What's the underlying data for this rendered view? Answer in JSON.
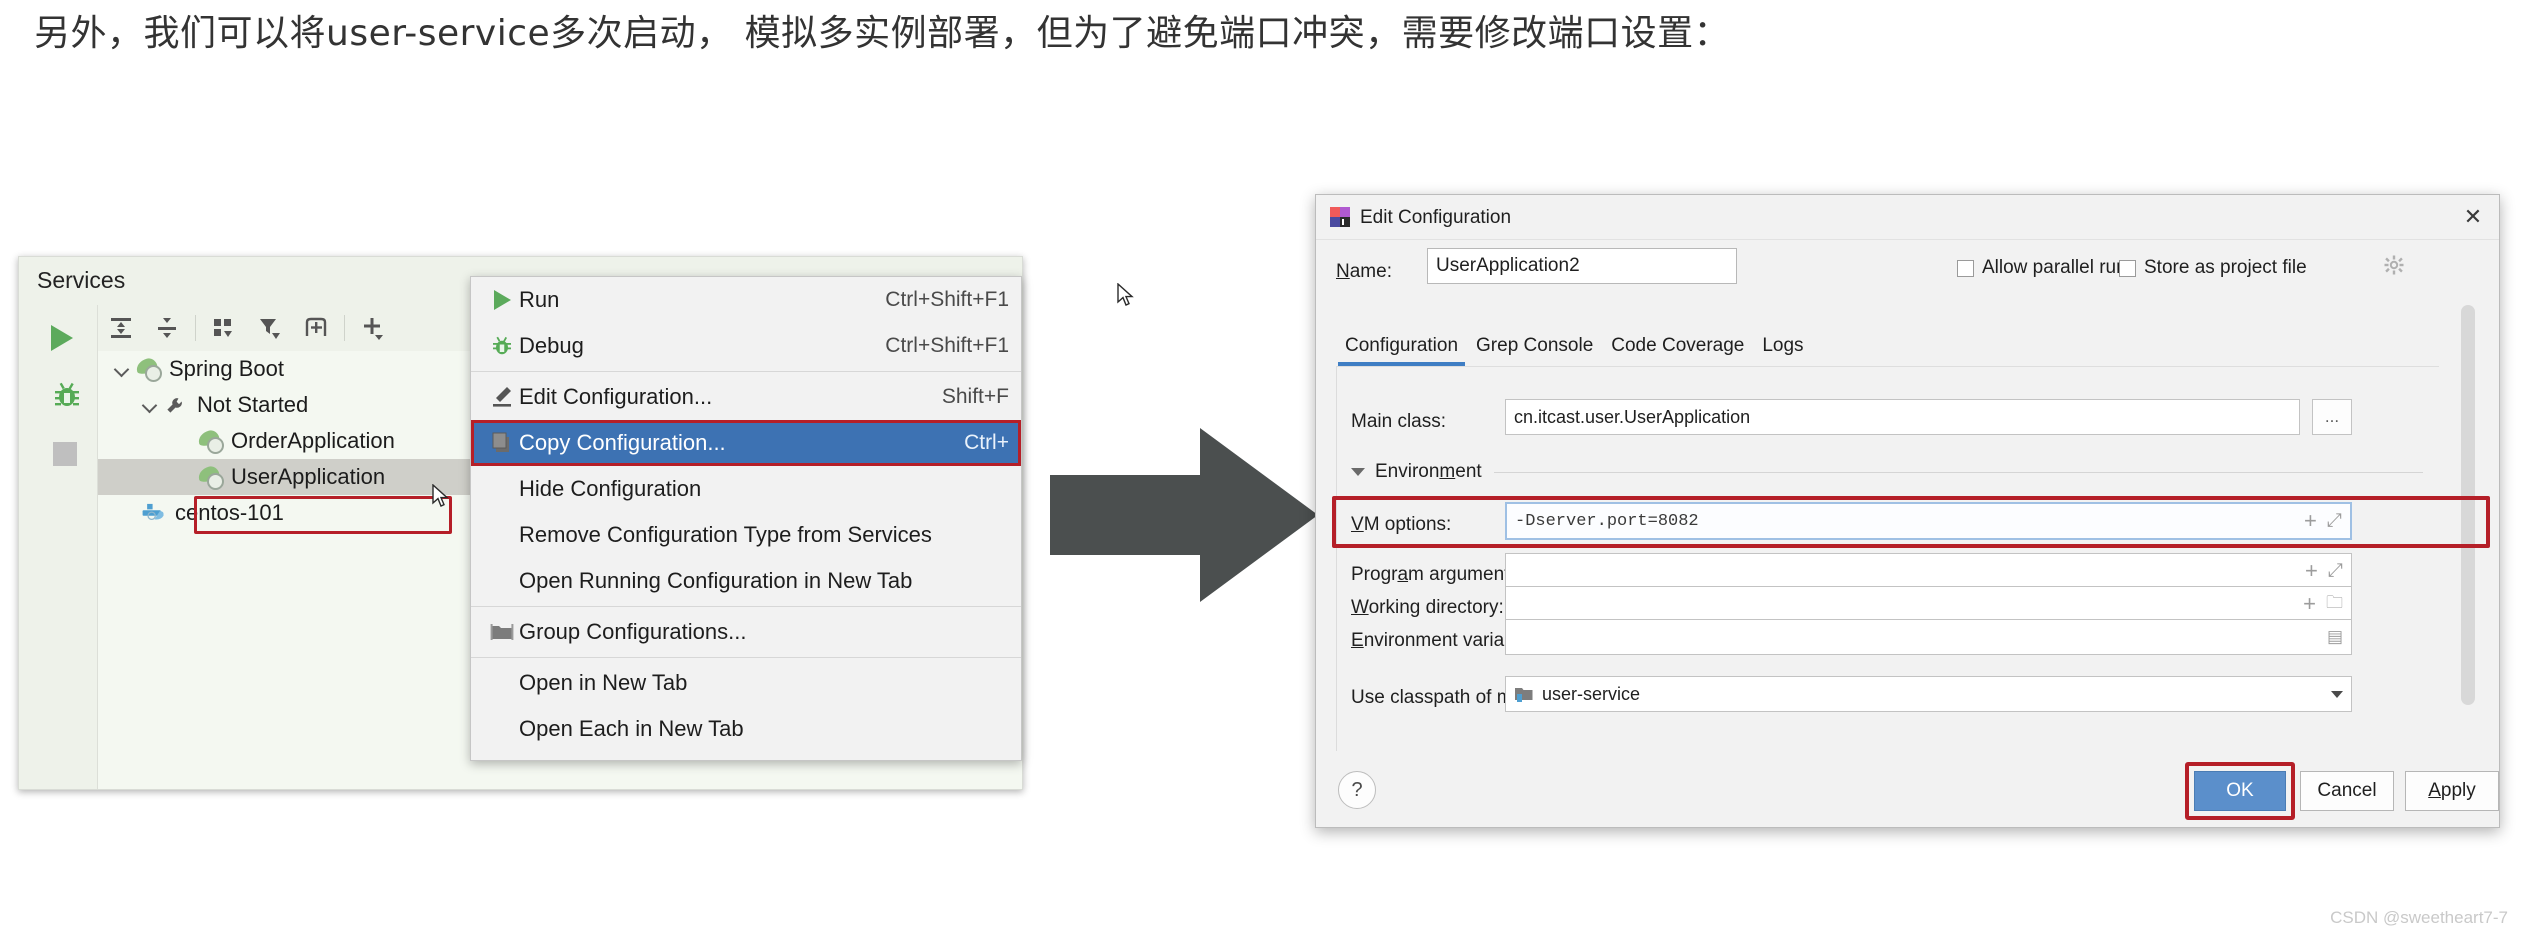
{
  "heading": "另外，我们可以将user-service多次启动， 模拟多实例部署，但为了避免端口冲突，需要修改端口设置：",
  "services": {
    "title": "Services",
    "gutter": [
      {
        "name": "run-icon",
        "label": "Run"
      },
      {
        "name": "debug-icon",
        "label": "Debug"
      },
      {
        "name": "stop-icon",
        "label": "Stop"
      }
    ],
    "toolbar": [
      {
        "name": "expand-all-icon",
        "label": "Expand All"
      },
      {
        "name": "collapse-all-icon",
        "label": "Collapse All"
      },
      {
        "name": "group-by-icon",
        "label": "Group By"
      },
      {
        "name": "filter-icon",
        "label": "Filter"
      },
      {
        "name": "add-tab-icon",
        "label": "Add Tab"
      },
      {
        "name": "add-icon",
        "label": "Add"
      }
    ],
    "tree": [
      {
        "label": "Spring Boot",
        "icon": "spring-boot-icon",
        "indent": 0,
        "expanded": true,
        "selected": false
      },
      {
        "label": "Not Started",
        "icon": "wrench-icon",
        "indent": 1,
        "expanded": true,
        "selected": false
      },
      {
        "label": "OrderApplication",
        "icon": "spring-boot-icon",
        "indent": 2,
        "expanded": false,
        "selected": false
      },
      {
        "label": "UserApplication",
        "icon": "spring-boot-icon",
        "indent": 2,
        "expanded": false,
        "selected": true
      },
      {
        "label": "centos-101",
        "icon": "docker-icon",
        "indent": 0,
        "expanded": false,
        "selected": false
      }
    ]
  },
  "context_menu": {
    "items": [
      {
        "label": "Run",
        "shortcut": "Ctrl+Shift+F1",
        "icon": "run-icon",
        "highlight": false,
        "sep_after": true
      },
      {
        "label": "Debug",
        "shortcut": "Ctrl+Shift+F1",
        "icon": "debug-icon",
        "highlight": false,
        "sep_after": false
      },
      {
        "label": "Edit Configuration...",
        "shortcut": "Shift+F",
        "icon": "pencil-icon",
        "highlight": false,
        "sep_after": false
      },
      {
        "label": "Copy Configuration...",
        "shortcut": "Ctrl+",
        "icon": "copy-icon",
        "highlight": true,
        "sep_after": false
      },
      {
        "label": "Hide Configuration",
        "shortcut": "",
        "icon": "",
        "highlight": false,
        "sep_after": false
      },
      {
        "label": "Remove Configuration Type from Services",
        "shortcut": "",
        "icon": "",
        "highlight": false,
        "sep_after": false
      },
      {
        "label": "Open Running Configuration in New Tab",
        "shortcut": "",
        "icon": "",
        "highlight": false,
        "sep_after": true
      },
      {
        "label": "Group Configurations...",
        "shortcut": "",
        "icon": "folder-icon",
        "highlight": false,
        "sep_after": true
      },
      {
        "label": "Open in New Tab",
        "shortcut": "",
        "icon": "",
        "highlight": false,
        "sep_after": false
      },
      {
        "label": "Open Each in New Tab",
        "shortcut": "",
        "icon": "",
        "highlight": false,
        "sep_after": false
      }
    ]
  },
  "dialog": {
    "title": "Edit Configuration",
    "close_label": "✕",
    "name_label": "Name:",
    "name_value": "UserApplication2",
    "allow_parallel_run": "Allow parallel run",
    "store_as_project_file": "Store as project file",
    "tabs": [
      {
        "label": "Configuration",
        "active": true
      },
      {
        "label": "Grep Console",
        "active": false
      },
      {
        "label": "Code Coverage",
        "active": false
      },
      {
        "label": "Logs",
        "active": false
      }
    ],
    "main_class_label": "Main class:",
    "main_class_value": "cn.itcast.user.UserApplication",
    "browse_label": "...",
    "environment_label": "Environment",
    "vm_options_label": "VM options:",
    "vm_options_value": "-Dserver.port=8082",
    "program_arguments_label": "Program arguments:",
    "program_arguments_value": "",
    "working_directory_label": "Working directory:",
    "working_directory_value": "",
    "environment_variables_label": "Environment variables:",
    "environment_variables_value": "",
    "use_classpath_label": "Use classpath of module:",
    "use_classpath_value": "user-service",
    "help_label": "?",
    "ok_label": "OK",
    "cancel_label": "Cancel",
    "apply_label": "Apply"
  },
  "watermark": "CSDN @sweetheart7-7",
  "colors": {
    "highlight_blue": "#3d72b3",
    "annotation_red": "#b51f28",
    "accent_tab": "#3f7ec4",
    "ok_button": "#5b8fcb",
    "spring_green": "#8ec07c",
    "docker_blue": "#4e9fd1"
  }
}
